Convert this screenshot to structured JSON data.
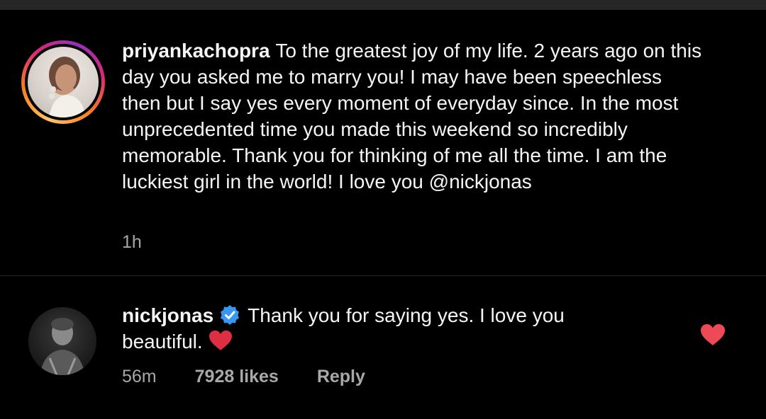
{
  "caption": {
    "username": "priyankachopra",
    "text": "To the greatest joy of my life. 2 years ago on this day you asked me to marry you! I may have been speechless then but I say yes every moment of everyday since. In the most unprecedented time you made this weekend so incredibly memorable. Thank you for thinking of me all the time. I am the luckiest girl in the world! I love you",
    "mention": "@nickjonas",
    "time": "1h"
  },
  "comment": {
    "username": "nickjonas",
    "verified": true,
    "text": "Thank you for saying yes. I love you beautiful.",
    "emoji": "heart-emoji",
    "time": "56m",
    "likes": "7928 likes",
    "reply_label": "Reply",
    "liked": true
  },
  "colors": {
    "background": "#000000",
    "text": "#f5f5f5",
    "secondary_text": "#a8a8a8",
    "verified_blue": "#3897f0",
    "heart_red": "#ed4956",
    "divider": "#262626"
  },
  "icons": {
    "verified": "verified-badge-icon",
    "like": "heart-icon"
  }
}
